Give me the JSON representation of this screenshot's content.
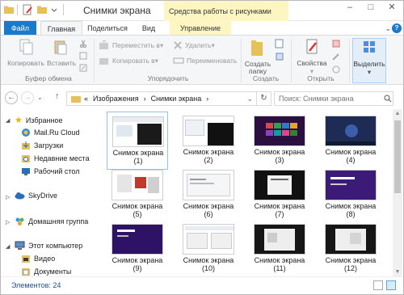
{
  "window": {
    "title": "Снимки экрана",
    "context_tab_header": "Средства работы с рисунками",
    "controls": [
      "–",
      "□",
      "✕"
    ]
  },
  "tabs": {
    "file": "Файл",
    "home": "Главная",
    "share": "Поделиться",
    "view": "Вид",
    "manage": "Управление"
  },
  "ribbon": {
    "clipboard": {
      "copy": "Копировать",
      "paste": "Вставить",
      "group": "Буфер обмена"
    },
    "organize": {
      "move_to": "Переместить в",
      "copy_to": "Копировать в",
      "delete": "Удалить",
      "rename": "Переименовать",
      "group": "Упорядочить"
    },
    "new": {
      "new_folder": "Создать\nпапку",
      "group": "Создать"
    },
    "open": {
      "properties": "Свойства",
      "group": "Открыть"
    },
    "select": {
      "select": "Выделить"
    }
  },
  "addressbar": {
    "breadcrumbs": [
      "«",
      "Изображения",
      "›",
      "Снимки экрана",
      "›"
    ],
    "search_placeholder": "Поиск: Снимки экрана"
  },
  "sidebar": {
    "items": [
      {
        "label": "Избранное",
        "icon": "star-icon"
      },
      {
        "label": "Mail.Ru Cloud",
        "icon": "cloud-icon"
      },
      {
        "label": "Загрузки",
        "icon": "downloads-icon"
      },
      {
        "label": "Недавние места",
        "icon": "recent-places-icon"
      },
      {
        "label": "Рабочий стол",
        "icon": "desktop-icon"
      },
      {
        "label": "SkyDrive",
        "icon": "skydrive-icon"
      },
      {
        "label": "Домашняя группа",
        "icon": "homegroup-icon"
      },
      {
        "label": "Этот компьютер",
        "icon": "computer-icon"
      },
      {
        "label": "Видео",
        "icon": "video-folder-icon"
      },
      {
        "label": "Документы",
        "icon": "documents-folder-icon"
      }
    ]
  },
  "files": [
    {
      "name": "Снимок экрана",
      "num": "(1)",
      "selected": true
    },
    {
      "name": "Снимок экрана",
      "num": "(2)"
    },
    {
      "name": "Снимок экрана",
      "num": "(3)"
    },
    {
      "name": "Снимок экрана",
      "num": "(4)"
    },
    {
      "name": "Снимок экрана",
      "num": "(5)"
    },
    {
      "name": "Снимок экрана",
      "num": "(6)"
    },
    {
      "name": "Снимок экрана",
      "num": "(7)"
    },
    {
      "name": "Снимок экрана",
      "num": "(8)"
    },
    {
      "name": "Снимок экрана",
      "num": "(9)"
    },
    {
      "name": "Снимок экрана",
      "num": "(10)"
    },
    {
      "name": "Снимок экрана",
      "num": "(11)"
    },
    {
      "name": "Снимок экрана",
      "num": "(12)"
    }
  ],
  "status": {
    "text": "Элементов: 24"
  },
  "colors": {
    "accent": "#1979ca",
    "context_tab": "#fdf6c3",
    "selection_border": "#8fc5ea"
  }
}
